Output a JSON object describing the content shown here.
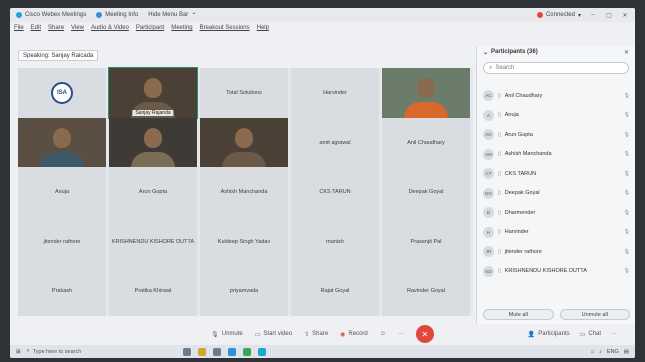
{
  "titlebar": {
    "app": "Cisco Webex Meetings",
    "info": "Meeting Info",
    "hide_menu": "Hide Menu Bar",
    "status": "Connected"
  },
  "menu": [
    "File",
    "Edit",
    "Share",
    "View",
    "Audio & Video",
    "Participant",
    "Meeting",
    "Breakout Sessions",
    "Help"
  ],
  "speaking": "Speaking: Sanjay Raicada",
  "tiles": [
    {
      "name": "",
      "kind": "isa",
      "logo_text": "ISA"
    },
    {
      "name": "Sanjay Rajanda",
      "kind": "video",
      "variant": "v1",
      "active": true
    },
    {
      "name": "Total Solutions",
      "kind": "name"
    },
    {
      "name": "Harvinder",
      "kind": "name"
    },
    {
      "name": "",
      "kind": "video",
      "variant": "orange"
    },
    {
      "name": "",
      "kind": "video",
      "variant": "v2"
    },
    {
      "name": "",
      "kind": "video",
      "variant": "v3"
    },
    {
      "name": "",
      "kind": "video",
      "variant": "v1"
    },
    {
      "name": "amit agrawal",
      "kind": "name"
    },
    {
      "name": "Anil Chaudhary",
      "kind": "name"
    },
    {
      "name": "Anuja",
      "kind": "name"
    },
    {
      "name": "Arun Gupta",
      "kind": "name"
    },
    {
      "name": "Ashish Manchanda",
      "kind": "name"
    },
    {
      "name": "CKS TARUN",
      "kind": "name"
    },
    {
      "name": "Deepak Goyal",
      "kind": "name"
    },
    {
      "name": "jitender rathore",
      "kind": "name"
    },
    {
      "name": "KRISHNENDU KISHORE DUTTA",
      "kind": "name"
    },
    {
      "name": "Kuldeep Singh Yadav",
      "kind": "name"
    },
    {
      "name": "manish",
      "kind": "name"
    },
    {
      "name": "Prasenjit Pal",
      "kind": "name"
    },
    {
      "name": "Prakash",
      "kind": "name"
    },
    {
      "name": "Pratika Khirwal",
      "kind": "name"
    },
    {
      "name": "priyamvada",
      "kind": "name"
    },
    {
      "name": "Rajat Goyal",
      "kind": "name"
    },
    {
      "name": "Ravinder Goyal",
      "kind": "name"
    }
  ],
  "panel": {
    "title": "Participants (36)",
    "search_placeholder": "Search",
    "participants": [
      {
        "initials": "AC",
        "name": "Anil Chaudhary"
      },
      {
        "initials": "A",
        "name": "Anuja"
      },
      {
        "initials": "AG",
        "name": "Arun Gupta"
      },
      {
        "initials": "AM",
        "name": "Ashish Manchanda"
      },
      {
        "initials": "CT",
        "name": "CKS TARUN"
      },
      {
        "initials": "DG",
        "name": "Deepak Goyal"
      },
      {
        "initials": "D",
        "name": "Dharmender"
      },
      {
        "initials": "H",
        "name": "Harvinder"
      },
      {
        "initials": "JR",
        "name": "jitender rathore"
      },
      {
        "initials": "KD",
        "name": "KRISHNENDU KISHORE DUTTA"
      }
    ],
    "mute_all": "Mute all",
    "unmute_all": "Unmute all"
  },
  "controls": {
    "unmute": "Unmute",
    "start_video": "Start video",
    "share": "Share",
    "record": "Record",
    "participants": "Participants",
    "chat": "Chat"
  },
  "taskbar": {
    "search": "Type here to search",
    "lang": "ENG"
  }
}
